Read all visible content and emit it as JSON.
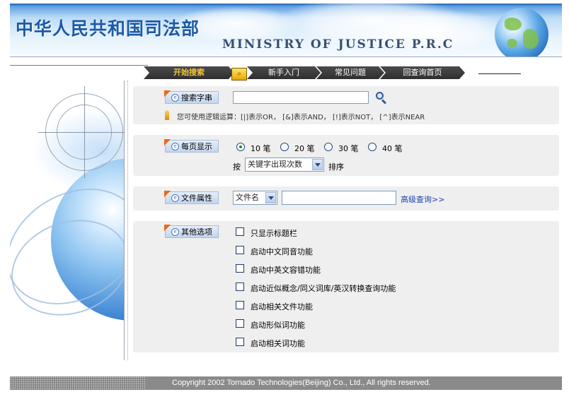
{
  "header": {
    "title_cn": "中华人民共和国司法部",
    "title_en": "MINISTRY OF JUSTICE P.R.C"
  },
  "nav": {
    "tabs": [
      {
        "label": "开始搜索",
        "active": true
      },
      {
        "label": "新手入门",
        "active": false
      },
      {
        "label": "常见问题",
        "active": false
      },
      {
        "label": "回查询首页",
        "active": false
      }
    ]
  },
  "search": {
    "label": "搜索字串",
    "input_value": "",
    "hint": "您可使用逻辑运算：[|]表示OR， [&]表示AND， [!]表示NOT， [^]表示NEAR"
  },
  "per_page": {
    "label": "每页显示",
    "options": [
      "10 笔",
      "20 笔",
      "30 笔",
      "40 笔"
    ],
    "selected_index": 0,
    "sort_prefix": "按",
    "sort_select_value": "关键字出现次数",
    "sort_suffix": "排序"
  },
  "file_attr": {
    "label": "文件属性",
    "select_value": "文件名",
    "input_value": "",
    "advanced_link": "高级查询>>"
  },
  "other_options": {
    "label": "其他选项",
    "items": [
      {
        "label": "只显示标题栏",
        "checked": false
      },
      {
        "label": "启动中文同音功能",
        "checked": false
      },
      {
        "label": "启动中英文容错功能",
        "checked": false
      },
      {
        "label": "启动近似概念/同义词库/英汉转换查询功能",
        "checked": false
      },
      {
        "label": "启动相关文件功能",
        "checked": false
      },
      {
        "label": "启动形似词功能",
        "checked": false
      },
      {
        "label": "启动相关词功能",
        "checked": false
      }
    ]
  },
  "footer": {
    "copyright": "Copyright 2002 Tornado Technologies(Beijing) Co., Ltd., All rights reserved."
  },
  "colors": {
    "brand_blue": "#1c5aa8",
    "nav_dark": "#3a3a3a",
    "nav_active": "#f2c23c",
    "panel_bg": "#efefef",
    "link": "#1a3fb0"
  }
}
